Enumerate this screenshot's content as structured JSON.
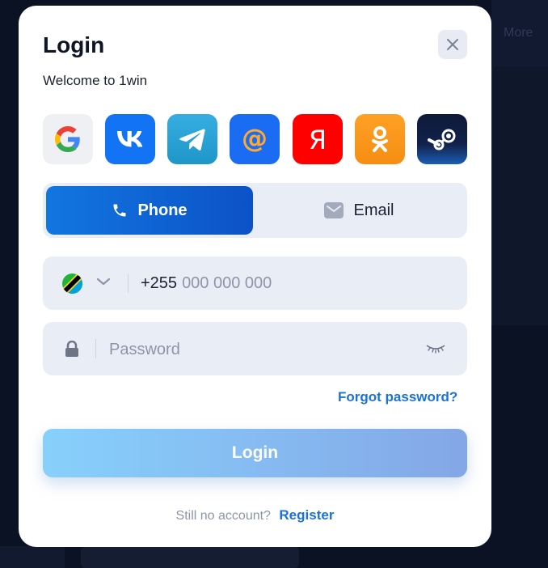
{
  "background": {
    "more_label": "More"
  },
  "modal": {
    "title": "Login",
    "subtitle": "Welcome to 1win",
    "close_icon": "close-icon"
  },
  "socials": [
    {
      "name": "google",
      "icon": "google-icon"
    },
    {
      "name": "vk",
      "icon": "vk-icon",
      "glyph": "VK"
    },
    {
      "name": "telegram",
      "icon": "telegram-icon"
    },
    {
      "name": "mail-ru",
      "icon": "at-sign-icon",
      "glyph": "@"
    },
    {
      "name": "yandex",
      "icon": "yandex-icon",
      "glyph": "Я"
    },
    {
      "name": "odnoklassniki",
      "icon": "ok-icon"
    },
    {
      "name": "steam",
      "icon": "steam-icon"
    }
  ],
  "tabs": {
    "phone_label": "Phone",
    "email_label": "Email",
    "active": "phone"
  },
  "phone": {
    "country_flag": "tanzania-flag",
    "prefix": "+255",
    "placeholder": "000 000 000"
  },
  "password": {
    "placeholder": "Password"
  },
  "forgot_label": "Forgot password?",
  "login_label": "Login",
  "footer": {
    "still_text": "Still no account?",
    "register_label": "Register"
  },
  "colors": {
    "accent": "#1a72d6",
    "tab_active": "#0b52c7",
    "field_bg": "#e9edf6",
    "login_gradient_start": "#87d0fc",
    "login_gradient_end": "#84a7e6"
  }
}
